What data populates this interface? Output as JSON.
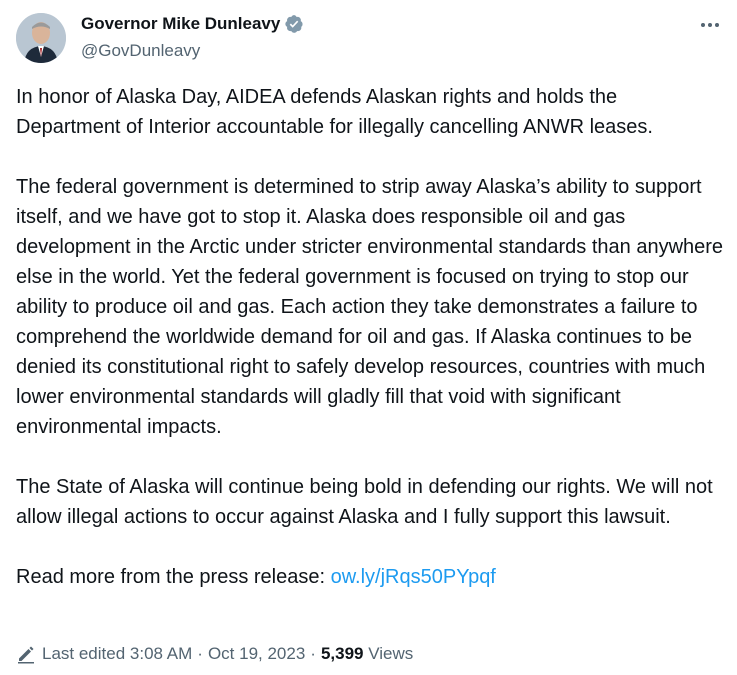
{
  "author": {
    "name": "Governor Mike Dunleavy",
    "handle": "@GovDunleavy",
    "avatar_icon": "avatar",
    "verified_icon": "verified-badge-icon",
    "verified_color": "#829aab"
  },
  "more_icon": "more-horizontal-icon",
  "tweet": {
    "paragraph_1": "In honor of Alaska Day, AIDEA defends Alaskan rights and holds the Department of Interior accountable for illegally cancelling ANWR leases.",
    "paragraph_2": "The federal government is determined to strip away Alaska’s ability to support itself, and we have got to stop it. Alaska does responsible oil and gas development in the Arctic under stricter environmental standards than anywhere else in the world. Yet the federal government is focused on trying to stop our ability to produce oil and gas. Each action they take demonstrates a failure to comprehend the worldwide demand for oil and gas. If Alaska continues to be denied its constitutional right to safely develop resources, countries with much lower environmental standards will gladly fill that void with significant environmental impacts.",
    "paragraph_3": "The State of Alaska will continue being bold in defending our rights. We will not allow illegal actions to occur against Alaska and I fully support this lawsuit.",
    "paragraph_4_prefix": "Read more from the press release: ",
    "link_text": "ow.ly/jRqs50PYpqf",
    "link_color": "#1d9bf0"
  },
  "meta": {
    "edit_icon": "edit-pencil-icon",
    "edited_label": "Last edited 3:08 AM",
    "separator": "·",
    "date": "Oct 19, 2023",
    "views_count": "5,399",
    "views_label": "Views"
  }
}
